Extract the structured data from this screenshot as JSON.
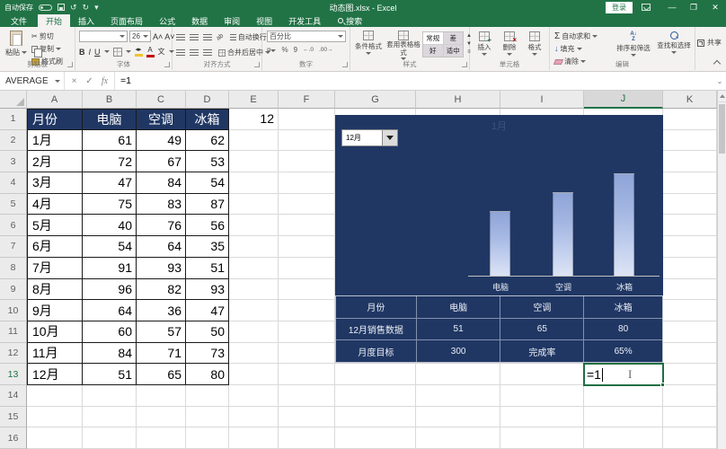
{
  "titlebar": {
    "autosave": "自动保存",
    "title": "动态图.xlsx - Excel",
    "signin": "登录"
  },
  "tabs": {
    "file": "文件",
    "items": [
      "开始",
      "插入",
      "页面布局",
      "公式",
      "数据",
      "审阅",
      "视图",
      "开发工具"
    ],
    "active": "开始",
    "search": "搜索"
  },
  "ribbon": {
    "share": "共享",
    "clipboard": {
      "label": "剪贴板",
      "paste": "粘贴",
      "cut": "剪切",
      "copy": "复制",
      "painter": "格式刷"
    },
    "font": {
      "label": "字体",
      "size": "26"
    },
    "alignment": {
      "label": "对齐方式",
      "wrap": "自动换行",
      "merge": "合并后居中"
    },
    "number": {
      "label": "数字",
      "format": "百分比"
    },
    "styles": {
      "label": "样式",
      "conditional": "条件格式",
      "table_style": "套用表格格式",
      "gallery": [
        "常规",
        "差",
        "好",
        "适中"
      ]
    },
    "cells": {
      "label": "单元格",
      "insert": "插入",
      "del": "删除",
      "format": "格式"
    },
    "editing": {
      "label": "编辑",
      "autosum": "自动求和",
      "fill": "填充",
      "clear": "清除",
      "sort": "排序和筛选",
      "find": "查找和选择"
    }
  },
  "formula_bar": {
    "name_box": "AVERAGE",
    "fx": "fx",
    "formula": "=1"
  },
  "sheet": {
    "columns": [
      "A",
      "B",
      "C",
      "D",
      "E",
      "F",
      "G",
      "H",
      "I",
      "J",
      "K"
    ],
    "selected_column": "J",
    "row_count": 16,
    "active_row": 13,
    "e1_value": "12",
    "data_table": {
      "headers": [
        "月份",
        "电脑",
        "空调",
        "冰箱"
      ],
      "rows": [
        [
          "1月",
          "61",
          "49",
          "62"
        ],
        [
          "2月",
          "72",
          "67",
          "53"
        ],
        [
          "3月",
          "47",
          "84",
          "54"
        ],
        [
          "4月",
          "75",
          "83",
          "87"
        ],
        [
          "5月",
          "40",
          "76",
          "56"
        ],
        [
          "6月",
          "54",
          "64",
          "35"
        ],
        [
          "7月",
          "91",
          "93",
          "51"
        ],
        [
          "8月",
          "96",
          "82",
          "93"
        ],
        [
          "9月",
          "64",
          "36",
          "47"
        ],
        [
          "10月",
          "60",
          "57",
          "50"
        ],
        [
          "11月",
          "84",
          "71",
          "73"
        ],
        [
          "12月",
          "51",
          "65",
          "80"
        ]
      ]
    }
  },
  "chart": {
    "title": "1月",
    "dropdown_value": "12月",
    "chart_data": {
      "type": "bar",
      "categories": [
        "电脑",
        "空调",
        "冰箱"
      ],
      "values": [
        51,
        65,
        80
      ],
      "title": "1月",
      "xlabel": "",
      "ylabel": "",
      "ylim": [
        0,
        125
      ],
      "grid": false,
      "legend": "none",
      "background": "#203764",
      "bar_color_top": "#8FA5D8",
      "bar_color_bottom": "#DDE5F5"
    },
    "table": {
      "headers": [
        "月份",
        "电脑",
        "空调",
        "冰箱"
      ],
      "rows": [
        [
          "12月销售数据",
          "51",
          "65",
          "80"
        ],
        [
          "月度目标",
          "300",
          "完成率",
          "65%"
        ]
      ]
    }
  },
  "edit_cell": {
    "value": "=1"
  },
  "colors": {
    "excel_green": "#217346",
    "navy": "#203764"
  }
}
